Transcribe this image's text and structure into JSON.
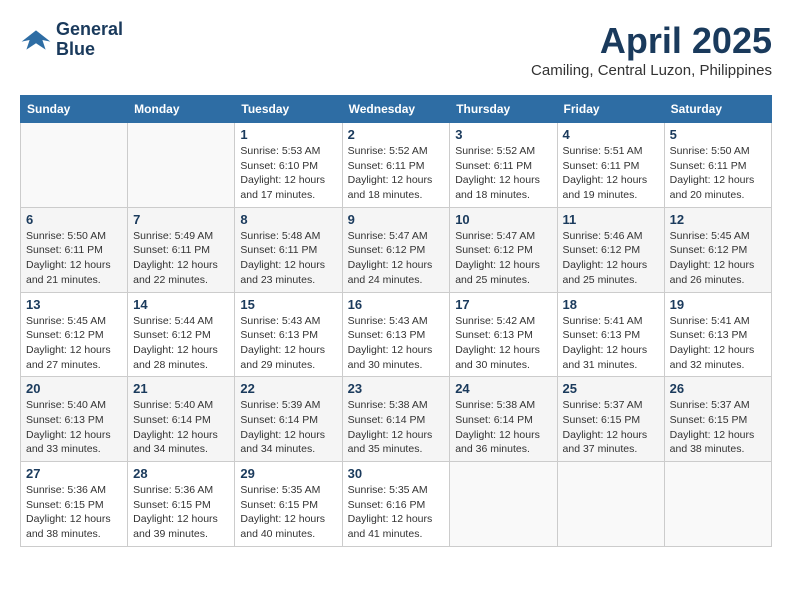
{
  "header": {
    "logo_line1": "General",
    "logo_line2": "Blue",
    "month": "April 2025",
    "location": "Camiling, Central Luzon, Philippines"
  },
  "weekdays": [
    "Sunday",
    "Monday",
    "Tuesday",
    "Wednesday",
    "Thursday",
    "Friday",
    "Saturday"
  ],
  "weeks": [
    [
      {
        "day": "",
        "sunrise": "",
        "sunset": "",
        "daylight": ""
      },
      {
        "day": "",
        "sunrise": "",
        "sunset": "",
        "daylight": ""
      },
      {
        "day": "1",
        "sunrise": "Sunrise: 5:53 AM",
        "sunset": "Sunset: 6:10 PM",
        "daylight": "Daylight: 12 hours and 17 minutes."
      },
      {
        "day": "2",
        "sunrise": "Sunrise: 5:52 AM",
        "sunset": "Sunset: 6:11 PM",
        "daylight": "Daylight: 12 hours and 18 minutes."
      },
      {
        "day": "3",
        "sunrise": "Sunrise: 5:52 AM",
        "sunset": "Sunset: 6:11 PM",
        "daylight": "Daylight: 12 hours and 18 minutes."
      },
      {
        "day": "4",
        "sunrise": "Sunrise: 5:51 AM",
        "sunset": "Sunset: 6:11 PM",
        "daylight": "Daylight: 12 hours and 19 minutes."
      },
      {
        "day": "5",
        "sunrise": "Sunrise: 5:50 AM",
        "sunset": "Sunset: 6:11 PM",
        "daylight": "Daylight: 12 hours and 20 minutes."
      }
    ],
    [
      {
        "day": "6",
        "sunrise": "Sunrise: 5:50 AM",
        "sunset": "Sunset: 6:11 PM",
        "daylight": "Daylight: 12 hours and 21 minutes."
      },
      {
        "day": "7",
        "sunrise": "Sunrise: 5:49 AM",
        "sunset": "Sunset: 6:11 PM",
        "daylight": "Daylight: 12 hours and 22 minutes."
      },
      {
        "day": "8",
        "sunrise": "Sunrise: 5:48 AM",
        "sunset": "Sunset: 6:11 PM",
        "daylight": "Daylight: 12 hours and 23 minutes."
      },
      {
        "day": "9",
        "sunrise": "Sunrise: 5:47 AM",
        "sunset": "Sunset: 6:12 PM",
        "daylight": "Daylight: 12 hours and 24 minutes."
      },
      {
        "day": "10",
        "sunrise": "Sunrise: 5:47 AM",
        "sunset": "Sunset: 6:12 PM",
        "daylight": "Daylight: 12 hours and 25 minutes."
      },
      {
        "day": "11",
        "sunrise": "Sunrise: 5:46 AM",
        "sunset": "Sunset: 6:12 PM",
        "daylight": "Daylight: 12 hours and 25 minutes."
      },
      {
        "day": "12",
        "sunrise": "Sunrise: 5:45 AM",
        "sunset": "Sunset: 6:12 PM",
        "daylight": "Daylight: 12 hours and 26 minutes."
      }
    ],
    [
      {
        "day": "13",
        "sunrise": "Sunrise: 5:45 AM",
        "sunset": "Sunset: 6:12 PM",
        "daylight": "Daylight: 12 hours and 27 minutes."
      },
      {
        "day": "14",
        "sunrise": "Sunrise: 5:44 AM",
        "sunset": "Sunset: 6:12 PM",
        "daylight": "Daylight: 12 hours and 28 minutes."
      },
      {
        "day": "15",
        "sunrise": "Sunrise: 5:43 AM",
        "sunset": "Sunset: 6:13 PM",
        "daylight": "Daylight: 12 hours and 29 minutes."
      },
      {
        "day": "16",
        "sunrise": "Sunrise: 5:43 AM",
        "sunset": "Sunset: 6:13 PM",
        "daylight": "Daylight: 12 hours and 30 minutes."
      },
      {
        "day": "17",
        "sunrise": "Sunrise: 5:42 AM",
        "sunset": "Sunset: 6:13 PM",
        "daylight": "Daylight: 12 hours and 30 minutes."
      },
      {
        "day": "18",
        "sunrise": "Sunrise: 5:41 AM",
        "sunset": "Sunset: 6:13 PM",
        "daylight": "Daylight: 12 hours and 31 minutes."
      },
      {
        "day": "19",
        "sunrise": "Sunrise: 5:41 AM",
        "sunset": "Sunset: 6:13 PM",
        "daylight": "Daylight: 12 hours and 32 minutes."
      }
    ],
    [
      {
        "day": "20",
        "sunrise": "Sunrise: 5:40 AM",
        "sunset": "Sunset: 6:13 PM",
        "daylight": "Daylight: 12 hours and 33 minutes."
      },
      {
        "day": "21",
        "sunrise": "Sunrise: 5:40 AM",
        "sunset": "Sunset: 6:14 PM",
        "daylight": "Daylight: 12 hours and 34 minutes."
      },
      {
        "day": "22",
        "sunrise": "Sunrise: 5:39 AM",
        "sunset": "Sunset: 6:14 PM",
        "daylight": "Daylight: 12 hours and 34 minutes."
      },
      {
        "day": "23",
        "sunrise": "Sunrise: 5:38 AM",
        "sunset": "Sunset: 6:14 PM",
        "daylight": "Daylight: 12 hours and 35 minutes."
      },
      {
        "day": "24",
        "sunrise": "Sunrise: 5:38 AM",
        "sunset": "Sunset: 6:14 PM",
        "daylight": "Daylight: 12 hours and 36 minutes."
      },
      {
        "day": "25",
        "sunrise": "Sunrise: 5:37 AM",
        "sunset": "Sunset: 6:15 PM",
        "daylight": "Daylight: 12 hours and 37 minutes."
      },
      {
        "day": "26",
        "sunrise": "Sunrise: 5:37 AM",
        "sunset": "Sunset: 6:15 PM",
        "daylight": "Daylight: 12 hours and 38 minutes."
      }
    ],
    [
      {
        "day": "27",
        "sunrise": "Sunrise: 5:36 AM",
        "sunset": "Sunset: 6:15 PM",
        "daylight": "Daylight: 12 hours and 38 minutes."
      },
      {
        "day": "28",
        "sunrise": "Sunrise: 5:36 AM",
        "sunset": "Sunset: 6:15 PM",
        "daylight": "Daylight: 12 hours and 39 minutes."
      },
      {
        "day": "29",
        "sunrise": "Sunrise: 5:35 AM",
        "sunset": "Sunset: 6:15 PM",
        "daylight": "Daylight: 12 hours and 40 minutes."
      },
      {
        "day": "30",
        "sunrise": "Sunrise: 5:35 AM",
        "sunset": "Sunset: 6:16 PM",
        "daylight": "Daylight: 12 hours and 41 minutes."
      },
      {
        "day": "",
        "sunrise": "",
        "sunset": "",
        "daylight": ""
      },
      {
        "day": "",
        "sunrise": "",
        "sunset": "",
        "daylight": ""
      },
      {
        "day": "",
        "sunrise": "",
        "sunset": "",
        "daylight": ""
      }
    ]
  ]
}
